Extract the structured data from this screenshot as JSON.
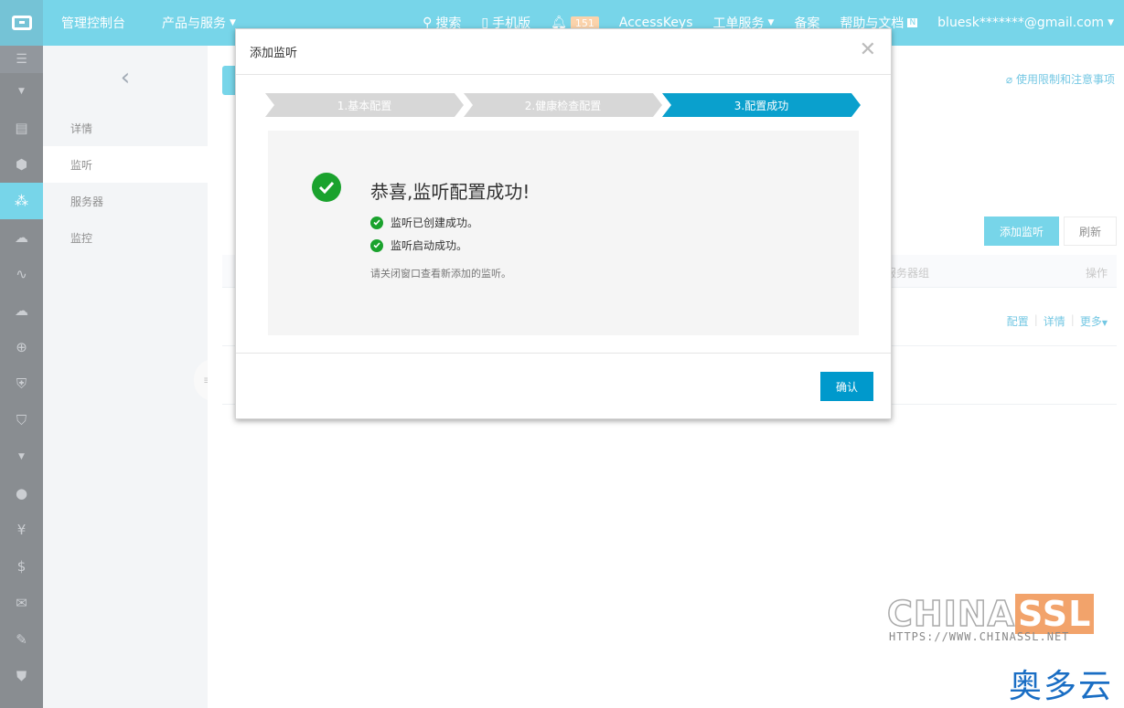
{
  "topbar": {
    "console": "管理控制台",
    "products": "产品与服务",
    "search": "搜索",
    "mobile": "手机版",
    "notif_count": "151",
    "accesskeys": "AccessKeys",
    "ticket": "工单服务",
    "beian": "备案",
    "help": "帮助与文档",
    "help_badge": "N",
    "user": "bluesk*******@gmail.com"
  },
  "sidebar": {
    "items": [
      {
        "label": "详情"
      },
      {
        "label": "监听"
      },
      {
        "label": "服务器"
      },
      {
        "label": "监控"
      }
    ]
  },
  "main": {
    "help_link": "使用限制和注意事项",
    "add_button": "添加监听",
    "refresh_button": "刷新",
    "col_group": "服务器组",
    "col_ops": "操作",
    "row_ops": {
      "config": "配置",
      "detail": "详情",
      "more": "更多"
    }
  },
  "modal": {
    "title": "添加监听",
    "steps": [
      "1.基本配置",
      "2.健康检查配置",
      "3.配置成功"
    ],
    "active_step": 3,
    "success_title": "恭喜,监听配置成功!",
    "check1": "监听已创建成功。",
    "check2": "监听启动成功。",
    "hint": "请关闭窗口查看新添加的监听。",
    "ok": "确认"
  },
  "watermark": {
    "china": "CHINA",
    "ssl": "SSL",
    "url": "HTTPS://WWW.CHINASSL.NET",
    "ado": "奥多云"
  },
  "colors": {
    "brand": "#09b2d8",
    "active_step": "#0aa0cd",
    "inactive_step": "#d7d7d7",
    "success": "#1aa22d"
  }
}
